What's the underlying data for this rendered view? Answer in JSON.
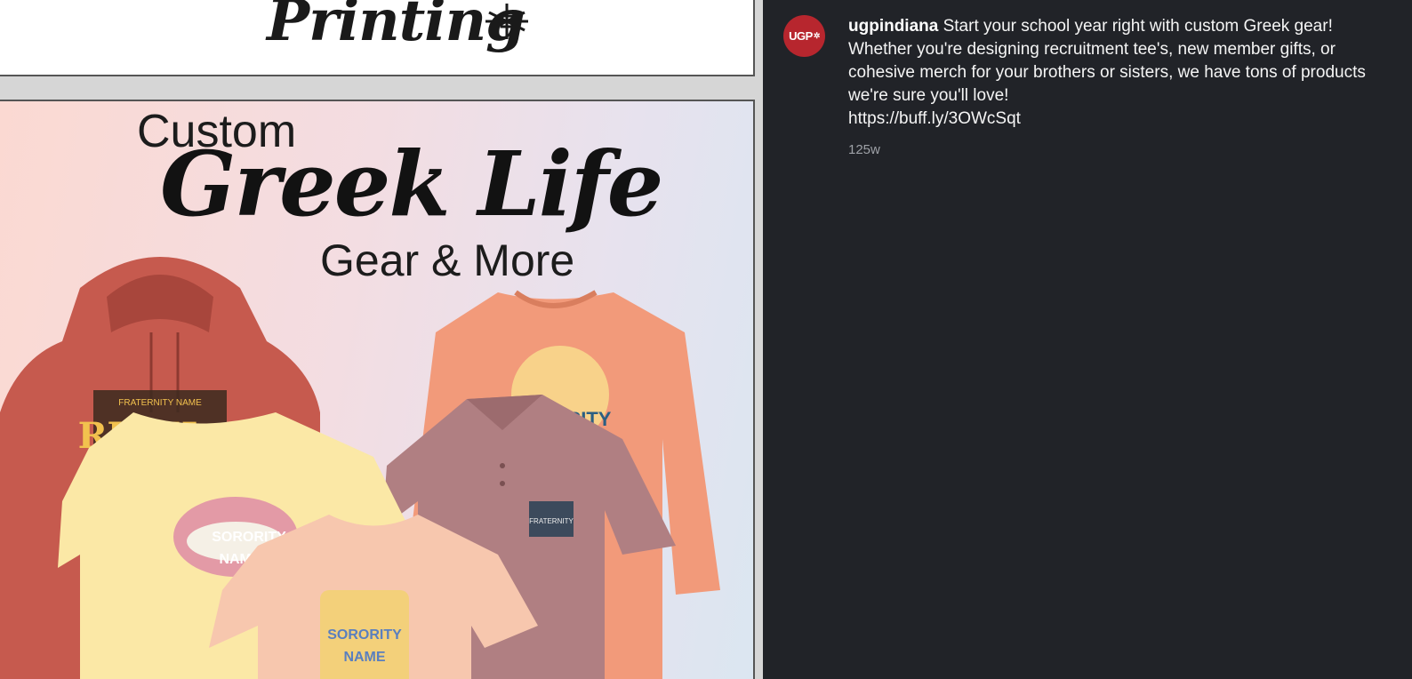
{
  "header": {
    "brand_word": "Printing"
  },
  "poster": {
    "line1": "Custom",
    "line2": "Greek Life",
    "line3": "Gear & More",
    "prints": {
      "hoodie": "FRATERNITY NAME",
      "hoodie_big": "RUSH",
      "crewneck": "SORORITY",
      "lips": "SORORITY",
      "lips_2": "NAME",
      "polo_badge": "FRATERNITY",
      "front_tee_1": "SORORITY",
      "front_tee_2": "NAME"
    },
    "colors": {
      "hoodie": "#c65a4e",
      "crewneck": "#f29a7a",
      "yellow_tee": "#fbe8a6",
      "polo": "#b07f82",
      "peach_tee": "#f7c7ae"
    }
  },
  "post": {
    "avatar_text": "UGP",
    "username": "ugpindiana",
    "caption": "Start your school year right with custom Greek gear! Whether you're designing recruitment tee's, new member gifts, or cohesive merch for your brothers or sisters, we have tons of products we're sure you'll love!",
    "link": "https://buff.ly/3OWcSqt",
    "age": "125w"
  }
}
